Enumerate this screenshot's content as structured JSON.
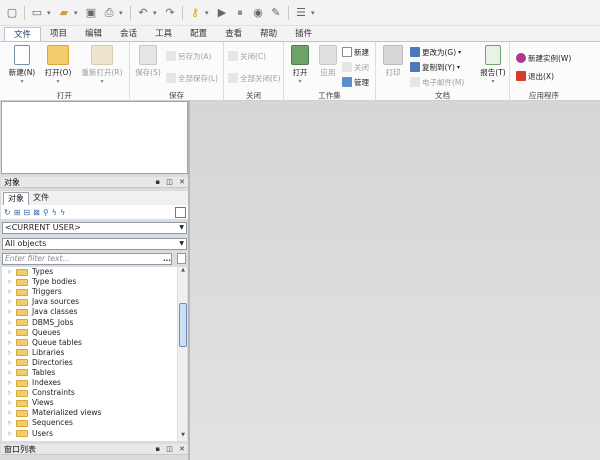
{
  "quick_toolbar": {
    "icons": [
      "window-icon",
      "new-doc-icon",
      "open-folder-icon",
      "save-icon",
      "print-icon",
      "undo-icon",
      "redo-icon",
      "key-icon",
      "run-icon",
      "stop-icon",
      "debug-icon",
      "tools-icon",
      "settings-icon"
    ]
  },
  "tabs": [
    "文件",
    "项目",
    "编辑",
    "会话",
    "工具",
    "配置",
    "查看",
    "帮助",
    "插件"
  ],
  "ribbon": {
    "open_group": {
      "label": "打开",
      "new": "新建(N)",
      "open": "打开(O)",
      "reopen": "重新打开(R)"
    },
    "save_group": {
      "label": "保存",
      "save": "保存(S)",
      "save_as": "另存为(A)",
      "save_all": "全部保存(L)"
    },
    "close_group": {
      "label": "关闭",
      "close": "关闭(C)",
      "close_all": "全部关闭(E)"
    },
    "workset_group": {
      "label": "工作集",
      "open": "打开",
      "apply": "应用",
      "new": "新建",
      "close": "关闭",
      "manage": "管理"
    },
    "document_group": {
      "label": "文档",
      "print": "打印",
      "change_to": "更改为(G)",
      "copy_to": "复制到(Y)",
      "email": "电子邮件(M)",
      "report": "报告(T)"
    },
    "app_group": {
      "label": "应用程序",
      "new_instance": "新建实例(W)",
      "exit": "退出(X)"
    }
  },
  "objects_panel": {
    "title": "对象",
    "tabs": [
      "对象",
      "文件"
    ],
    "user_select": "<CURRENT USER>",
    "type_select": "All objects",
    "filter_placeholder": "Enter filter text...",
    "filter_dots": "...",
    "items": [
      "Types",
      "Type bodies",
      "Triggers",
      "Java sources",
      "Java classes",
      "DBMS_Jobs",
      "Queues",
      "Queue tables",
      "Libraries",
      "Directories",
      "Tables",
      "Indexes",
      "Constraints",
      "Views",
      "Materialized views",
      "Sequences",
      "Users"
    ]
  },
  "window_list_panel": {
    "title": "窗口列表"
  },
  "colors": {
    "accent": "#1d3b6a",
    "tab_border": "#b7c6dc",
    "folder": "#f3cd6c"
  }
}
